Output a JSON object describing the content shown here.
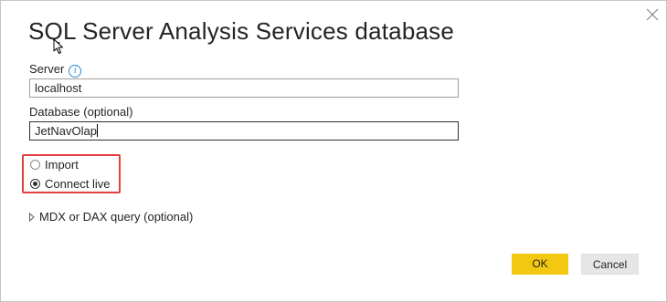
{
  "dialog": {
    "title": "SQL Server Analysis Services database",
    "close_icon": "close-icon"
  },
  "server": {
    "label": "Server",
    "info_icon": "info-icon",
    "info_glyph": "i",
    "value": "localhost"
  },
  "database": {
    "label": "Database (optional)",
    "value": "JetNavOlap"
  },
  "connectivity": {
    "options": [
      {
        "label": "Import",
        "selected": false
      },
      {
        "label": "Connect live",
        "selected": true
      }
    ],
    "highlight_color": "#e0403f"
  },
  "query": {
    "expander_label": "MDX or DAX query (optional)",
    "expanded": false
  },
  "buttons": {
    "ok_label": "OK",
    "cancel_label": "Cancel"
  },
  "colors": {
    "accent": "#f2c811",
    "info": "#2b88d8"
  }
}
